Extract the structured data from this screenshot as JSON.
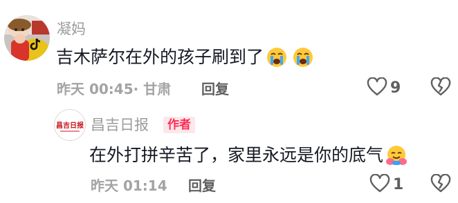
{
  "comment": {
    "username": "凝妈",
    "text": "吉木萨尔在外的孩子刷到了",
    "emojis": [
      "crying-face",
      "crying-face"
    ],
    "time": "昨天 00:45",
    "location": "· 甘肃",
    "reply_label": "回复",
    "like_count": "9"
  },
  "reply": {
    "username": "昌吉日报",
    "author_badge": "作者",
    "avatar_text": "昌吉日报",
    "text": "在外打拼辛苦了，家里永远是你的底气",
    "emoji": "hugging-face",
    "time": "昨天 01:14",
    "reply_label": "回复",
    "like_count": "1"
  },
  "colors": {
    "accent": "#fe2c55",
    "text": "#161823",
    "muted": "#9b9b9b",
    "icon": "#5f5f5f"
  }
}
